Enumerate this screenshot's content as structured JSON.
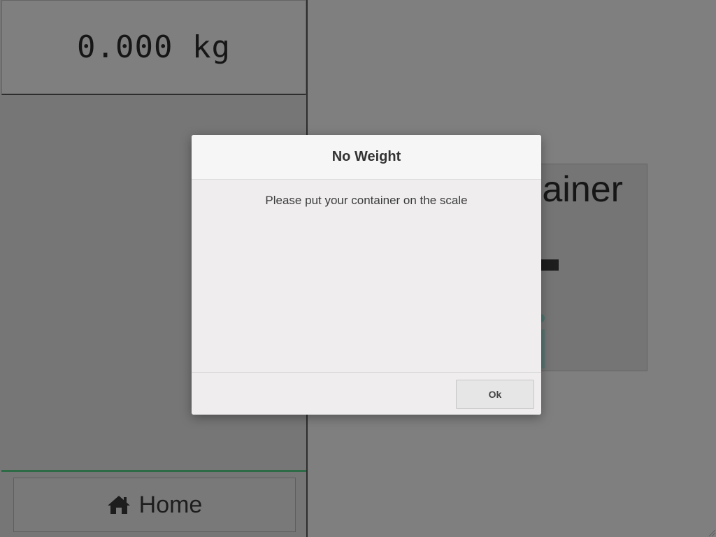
{
  "scale": {
    "weight_reading": "0.000 kg"
  },
  "nav": {
    "home_label": "Home",
    "home_icon": "home-icon"
  },
  "container_card": {
    "title_fragment": "ainer"
  },
  "dialog": {
    "title": "No Weight",
    "message": "Please put your container on the scale",
    "ok_label": "Ok"
  },
  "colors": {
    "accent_green": "#58d68d",
    "overlay": "rgba(0,0,0,0.5)",
    "teal_accent": "#9fe6dc"
  }
}
